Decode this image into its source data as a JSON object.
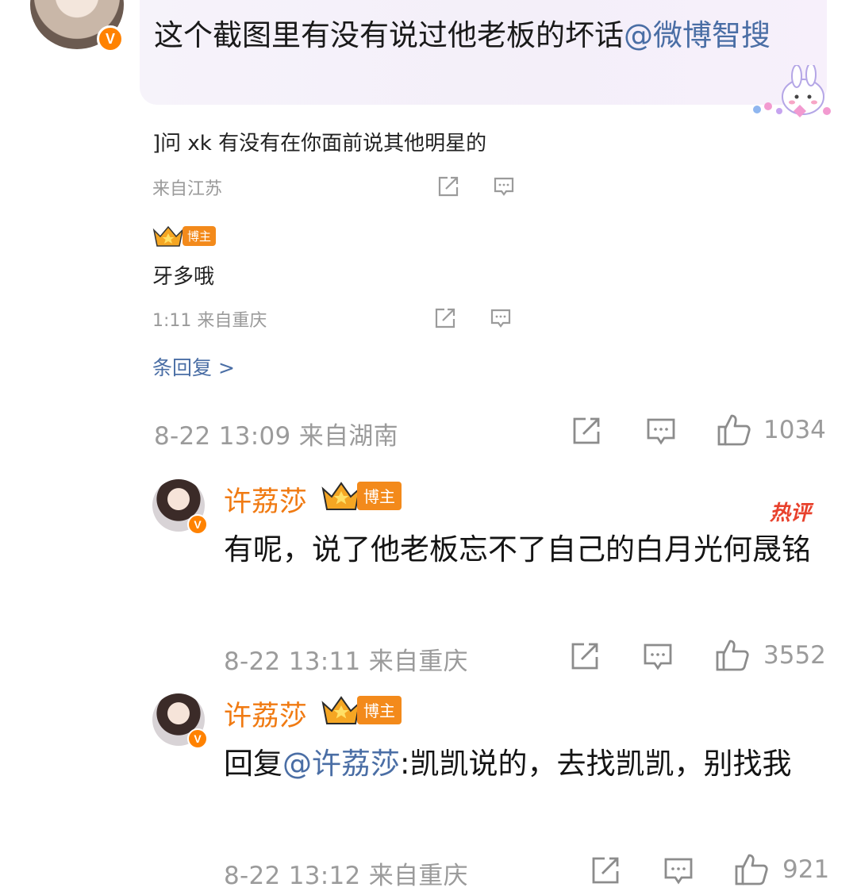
{
  "top_comment": {
    "text": "这个截图里有没有说过他老板的坏话",
    "mention": "@微博智搜",
    "verified_badge": "V"
  },
  "quoted_screenshot": {
    "comment_text": "]问 xk 有没有在你面前说其他明星的",
    "meta_1": "来自江苏",
    "user_badge": "博主",
    "reply_text": "牙多哦",
    "meta_2": "1:11 来自重庆",
    "view_replies": "条回复 >"
  },
  "top_comment_meta": {
    "time_location": "8-22 13:09 来自湖南",
    "likes": "1034"
  },
  "replies": [
    {
      "username": "许荔莎",
      "badge": "博主",
      "hot_label": "热评",
      "text": "有呢，说了他老板忘不了自己的白月光何晟铭",
      "time_location": "8-22 13:11 来自重庆",
      "likes": "3552"
    },
    {
      "username": "许荔莎",
      "badge": "博主",
      "reply_prefix": "回复",
      "mention": "@许荔莎",
      "text": ":凯凯说的，去找凯凯，别找我",
      "time_location": "8-22 13:12 来自重庆",
      "likes": "921"
    }
  ],
  "icons": [
    "share-icon",
    "comment-icon",
    "like-icon",
    "crown-icon",
    "verified-icon",
    "bunny-sticker-icon"
  ],
  "colors": {
    "username": "#f07a12",
    "mention": "#4a6ea5",
    "meta": "#9b9b9b",
    "badge": "#f38a1b",
    "hot": "#e8412c"
  }
}
